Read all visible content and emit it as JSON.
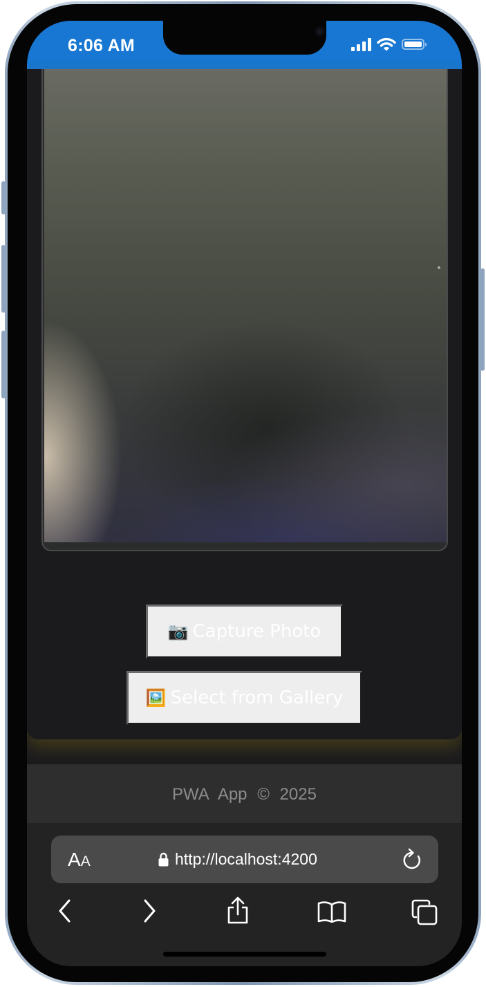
{
  "status_bar": {
    "time": "6:06 AM",
    "icons": [
      "cellular-signal-icon",
      "wifi-icon",
      "battery-icon"
    ],
    "color": "#1877d2"
  },
  "camera": {
    "preview": "live-camera-preview"
  },
  "actions": {
    "capture_emoji": "📷",
    "capture_label": "Capture Photo",
    "gallery_emoji": "🖼️",
    "gallery_label": "Select from Gallery"
  },
  "footer": {
    "text": "PWA App © 2025"
  },
  "browser": {
    "text_size_label": "A",
    "text_size_label_small": "A",
    "url": "http://localhost:4200",
    "toolbar_icons": [
      "back-icon",
      "forward-icon",
      "share-icon",
      "bookmarks-icon",
      "tabs-icon"
    ]
  }
}
